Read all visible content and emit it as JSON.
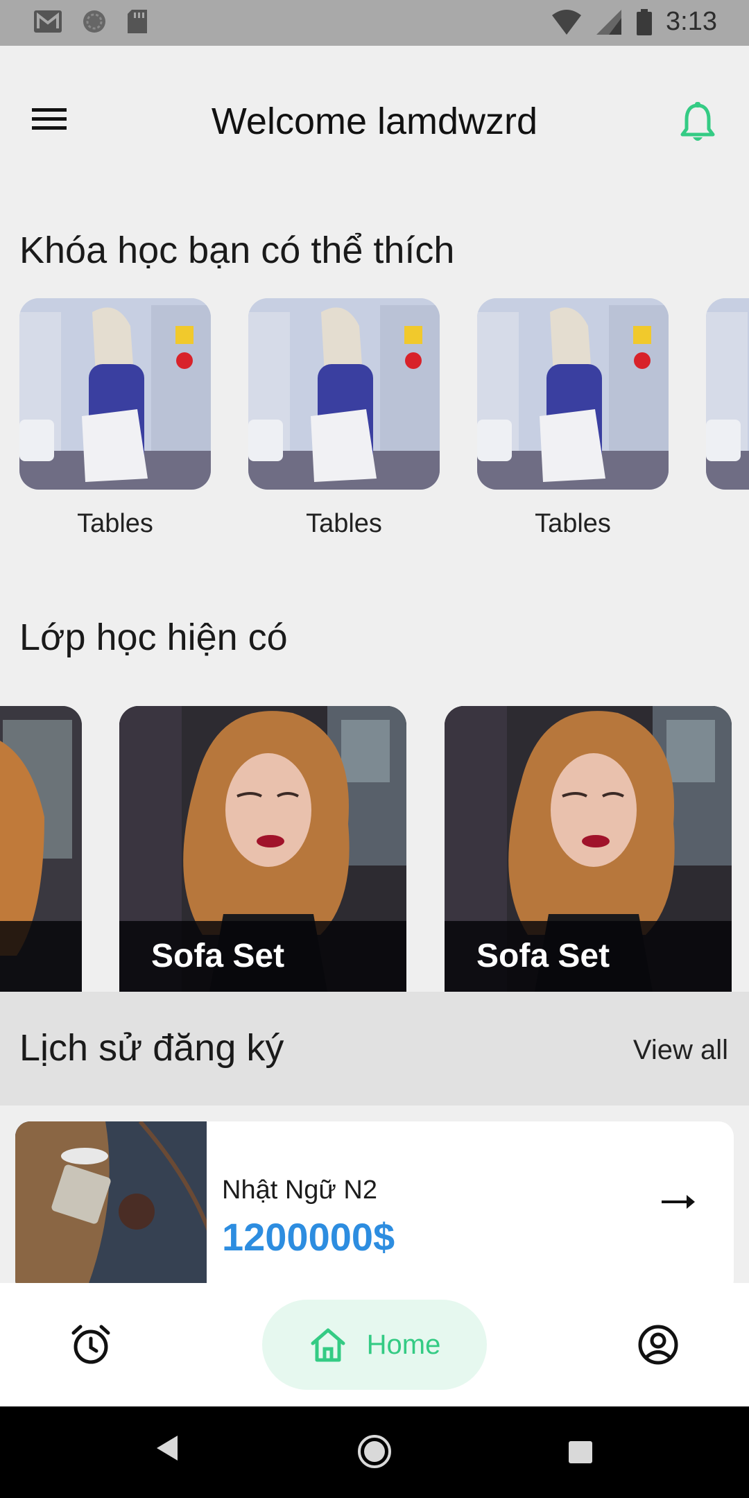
{
  "status_bar": {
    "time": "3:13",
    "icons": [
      "gmail-icon",
      "sync-icon",
      "sd-card-icon",
      "wifi-icon",
      "signal-icon",
      "battery-icon"
    ]
  },
  "header": {
    "title": "Welcome lamdwzrd",
    "menu_icon": "menu-icon",
    "bell_icon": "bell-icon"
  },
  "courses_section": {
    "title": "Khóa học bạn có thể thích",
    "items": [
      {
        "label": "Tables"
      },
      {
        "label": "Tables"
      },
      {
        "label": "Tables"
      },
      {
        "label": ""
      }
    ]
  },
  "classes_section": {
    "title": "Lớp học hiện có",
    "items": [
      {
        "label": ""
      },
      {
        "label": "Sofa Set"
      },
      {
        "label": "Sofa Set"
      }
    ]
  },
  "history_section": {
    "title": "Lịch sử đăng ký",
    "view_all": "View all",
    "items": [
      {
        "name": "Nhật Ngữ N2",
        "price": "1200000$"
      }
    ]
  },
  "bottom_nav": {
    "home_label": "Home",
    "icons": [
      "alarm-icon",
      "home-icon",
      "profile-icon"
    ]
  },
  "colors": {
    "accent": "#34cb84",
    "price": "#2d8de0",
    "background": "#efefef"
  }
}
